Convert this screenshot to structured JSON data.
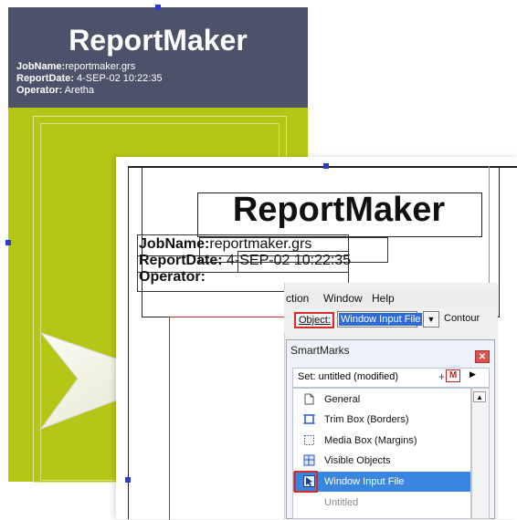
{
  "back_card": {
    "title": "ReportMaker",
    "job_label": "JobName:",
    "job_value": "reportmaker.grs",
    "date_label": "ReportDate:",
    "date_value": " 4-SEP-02 10:22:35",
    "operator_label": "Operator:",
    "operator_value": " Aretha",
    "colors": {
      "panel": "#b6c617",
      "header": "#4c526a"
    }
  },
  "front_card": {
    "title": "ReportMaker",
    "job_label": "JobName:",
    "job_value": "reportmaker.grs",
    "date_label": "ReportDate:",
    "date_value": " 4-SEP-02 10:22:35",
    "operator_label": "Operator:"
  },
  "window": {
    "menu": [
      "ction",
      "Window",
      "Help"
    ],
    "object_label": "Object:",
    "object_value": "Window Input File",
    "object_dropdown_icon": "chevron-down-icon",
    "contour_label": "Contour",
    "panel_title": "SmartMarks",
    "set_label": "Set:  untitled (modified)",
    "set_plus": "+",
    "set_m_icon": "M",
    "items": [
      {
        "label": "General",
        "icon": "page-icon",
        "selected": false
      },
      {
        "label": "Trim Box (Borders)",
        "icon": "trim-box-icon",
        "selected": false
      },
      {
        "label": "Media Box (Margins)",
        "icon": "media-box-icon",
        "selected": false
      },
      {
        "label": "Visible Objects",
        "icon": "visible-objects-icon",
        "selected": false
      },
      {
        "label": "Window Input File",
        "icon": "window-input-file-icon",
        "selected": true
      },
      {
        "label": "Untitled",
        "icon": "",
        "selected": false
      }
    ],
    "accent": "#3a86de",
    "highlight": "#d52b2b"
  }
}
